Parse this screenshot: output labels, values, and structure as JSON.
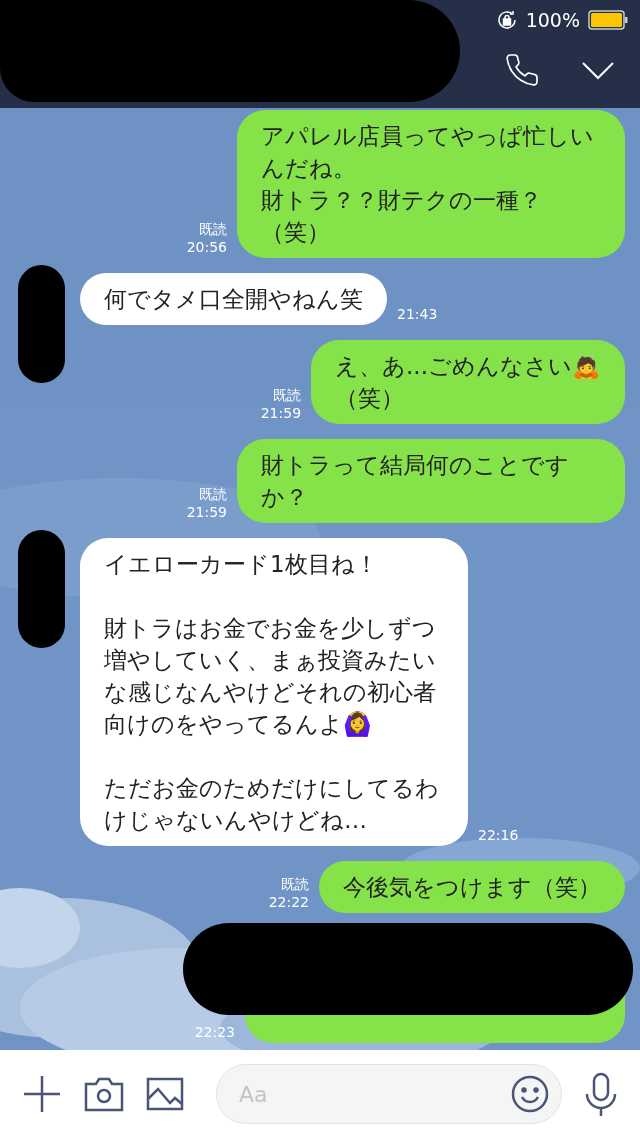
{
  "status_bar": {
    "battery": "100%"
  },
  "header": {
    "title_redacted": true
  },
  "messages": [
    {
      "kind": "sent",
      "paragraphs": [
        [
          "アパレル店員ってやっぱ忙しいんだね。",
          "財トラ？？財テクの一種？",
          "（笑）"
        ]
      ],
      "read": "既読",
      "time": "20:56",
      "redacted": false
    },
    {
      "kind": "received",
      "paragraphs": [
        [
          "何でタメ口全開やねん笑"
        ]
      ],
      "time": "21:43",
      "redacted": false
    },
    {
      "kind": "sent",
      "paragraphs": [
        [
          "え、あ...ごめんなさい🙇",
          "（笑）"
        ]
      ],
      "read": "既読",
      "time": "21:59",
      "redacted": false
    },
    {
      "kind": "sent",
      "paragraphs": [
        [
          "財トラって結局何のことですか？"
        ]
      ],
      "read": "既読",
      "time": "21:59",
      "redacted": false
    },
    {
      "kind": "received",
      "paragraphs": [
        [
          "イエローカード1枚目ね！"
        ],
        [
          "財トラはお金でお金を少しずつ増やしていく、まぁ投資みたいな感じなんやけどそれの初心者向けのをやってるんよ🙆‍♀️"
        ],
        [
          "ただお金のためだけにしてるわけじゃないんやけどね…"
        ]
      ],
      "time": "22:16",
      "redacted": false
    },
    {
      "kind": "sent",
      "paragraphs": [
        [
          "今後気をつけます（笑）"
        ]
      ],
      "read": "既読",
      "time": "22:22",
      "redacted": false
    },
    {
      "kind": "sent",
      "time": "22:23",
      "redacted": true
    }
  ],
  "input": {
    "placeholder": "Aa"
  }
}
